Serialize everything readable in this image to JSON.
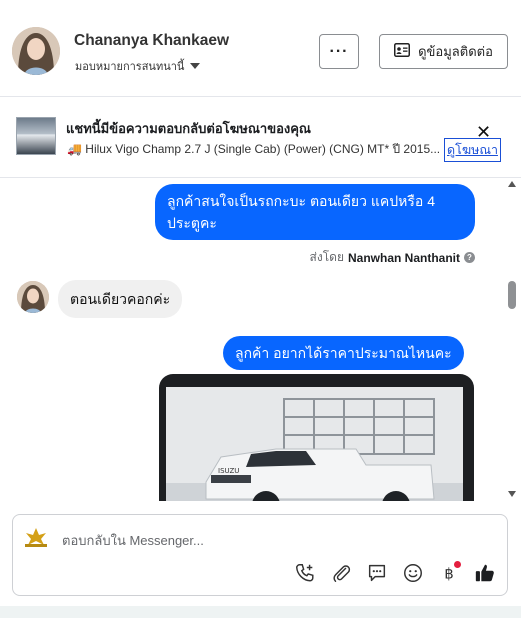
{
  "header": {
    "contact_name": "Chananya Khankaew",
    "assignee_label": "มอบหมายการสนทนานี้",
    "more_label": "···",
    "contact_info_label": "ดูข้อมูลติดต่อ"
  },
  "ad": {
    "title": "แชทนี้มีข้อความตอบกลับต่อโฆษณาของคุณ",
    "subtitle": "🚚 Hilux Vigo Champ 2.7 J (Single Cab) (Power) (CNG) MT* ปี 2015...",
    "link_label": "ดูโฆษณา",
    "close_label": "✕"
  },
  "messages": {
    "m1": "ลูกค้าสนใจเป็นรถกะบะ ตอนเดียว แคปหรือ 4 ประตูคะ",
    "sent_by_prefix": "ส่งโดย",
    "sent_by_name": "Nanwhan Nanthanit",
    "m2": "ตอนเดียวคอกค่ะ",
    "m3": "ลูกค้า อยากได้ราคาประมาณไหนคะ"
  },
  "composer": {
    "placeholder": "ตอบกลับใน Messenger..."
  },
  "colors": {
    "outgoing_bubble": "#0866ff",
    "incoming_bubble": "#f0f0f0",
    "link": "#1a4fd6",
    "badge": "#e41e3f"
  },
  "icons": [
    "more-icon",
    "contact-card-icon",
    "close-icon",
    "call-add-icon",
    "attach-icon",
    "saved-replies-icon",
    "emoji-icon",
    "baht-icon",
    "like-icon",
    "help-icon",
    "caret-down-icon"
  ]
}
